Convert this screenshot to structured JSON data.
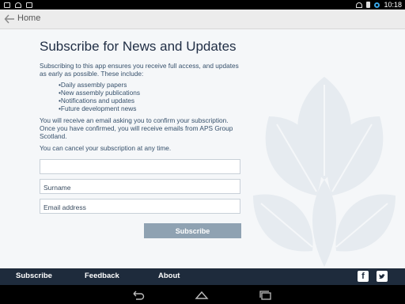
{
  "status_bar": {
    "time": "10:18"
  },
  "action_bar": {
    "title": "Home"
  },
  "main": {
    "heading": "Subscribe for News and Updates",
    "intro": "Subscribing to this app ensures you receive full access, and updates as early as possible. These include:",
    "bullets": [
      "•Daily assembly papers",
      "•New assembly publications",
      "•Notifications and updates",
      "•Future development news"
    ],
    "confirm_text": "You will receive an email asking you to confirm your subscription. Once you have confirmed, you will receive emails from APS Group Scotland.",
    "cancel_text": "You can cancel your subscription at any time.",
    "fields": {
      "first": {
        "placeholder": "",
        "value": ""
      },
      "surname": {
        "placeholder": "Surname",
        "value": ""
      },
      "email": {
        "placeholder": "Email address",
        "value": ""
      }
    },
    "submit_label": "Subscribe"
  },
  "footer": {
    "links": [
      "Subscribe",
      "Feedback",
      "About"
    ],
    "social": {
      "facebook_glyph": "f"
    }
  },
  "colors": {
    "footer_bg": "#1e2b3c",
    "button_bg": "#8fa2b2",
    "heading": "#1f2d44",
    "body_text": "#36506b"
  },
  "icons": [
    "back-arrow-icon",
    "facebook-icon",
    "twitter-icon",
    "nav-back-icon",
    "nav-home-icon",
    "nav-recents-icon"
  ]
}
